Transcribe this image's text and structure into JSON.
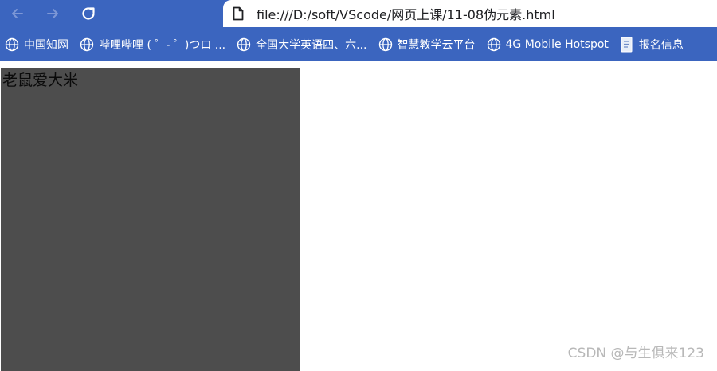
{
  "browser": {
    "nav": {
      "back_icon": "arrow-left-icon",
      "forward_icon": "arrow-right-icon",
      "reload_icon": "reload-icon"
    },
    "address_bar": {
      "icon": "file-icon",
      "url": "file:///D:/soft/VScode/网页上课/11-08伪元素.html"
    },
    "bookmarks": [
      {
        "label": "中国知网",
        "icon": "globe-icon"
      },
      {
        "label": "哔哩哔哩 ( ゜- ゜)つロ ...",
        "icon": "globe-icon"
      },
      {
        "label": "全国大学英语四、六...",
        "icon": "globe-icon"
      },
      {
        "label": "智慧教学云平台",
        "icon": "globe-icon"
      },
      {
        "label": "4G Mobile Hotspot",
        "icon": "globe-icon"
      },
      {
        "label": "报名信息",
        "icon": "document-icon"
      }
    ]
  },
  "page": {
    "box_text": "老鼠爱大米",
    "box_color": "#4d4d4d"
  },
  "watermark": "CSDN @与生俱来123",
  "colors": {
    "toolbar": "#3b65bf",
    "bookmark_text": "#ffffff"
  }
}
